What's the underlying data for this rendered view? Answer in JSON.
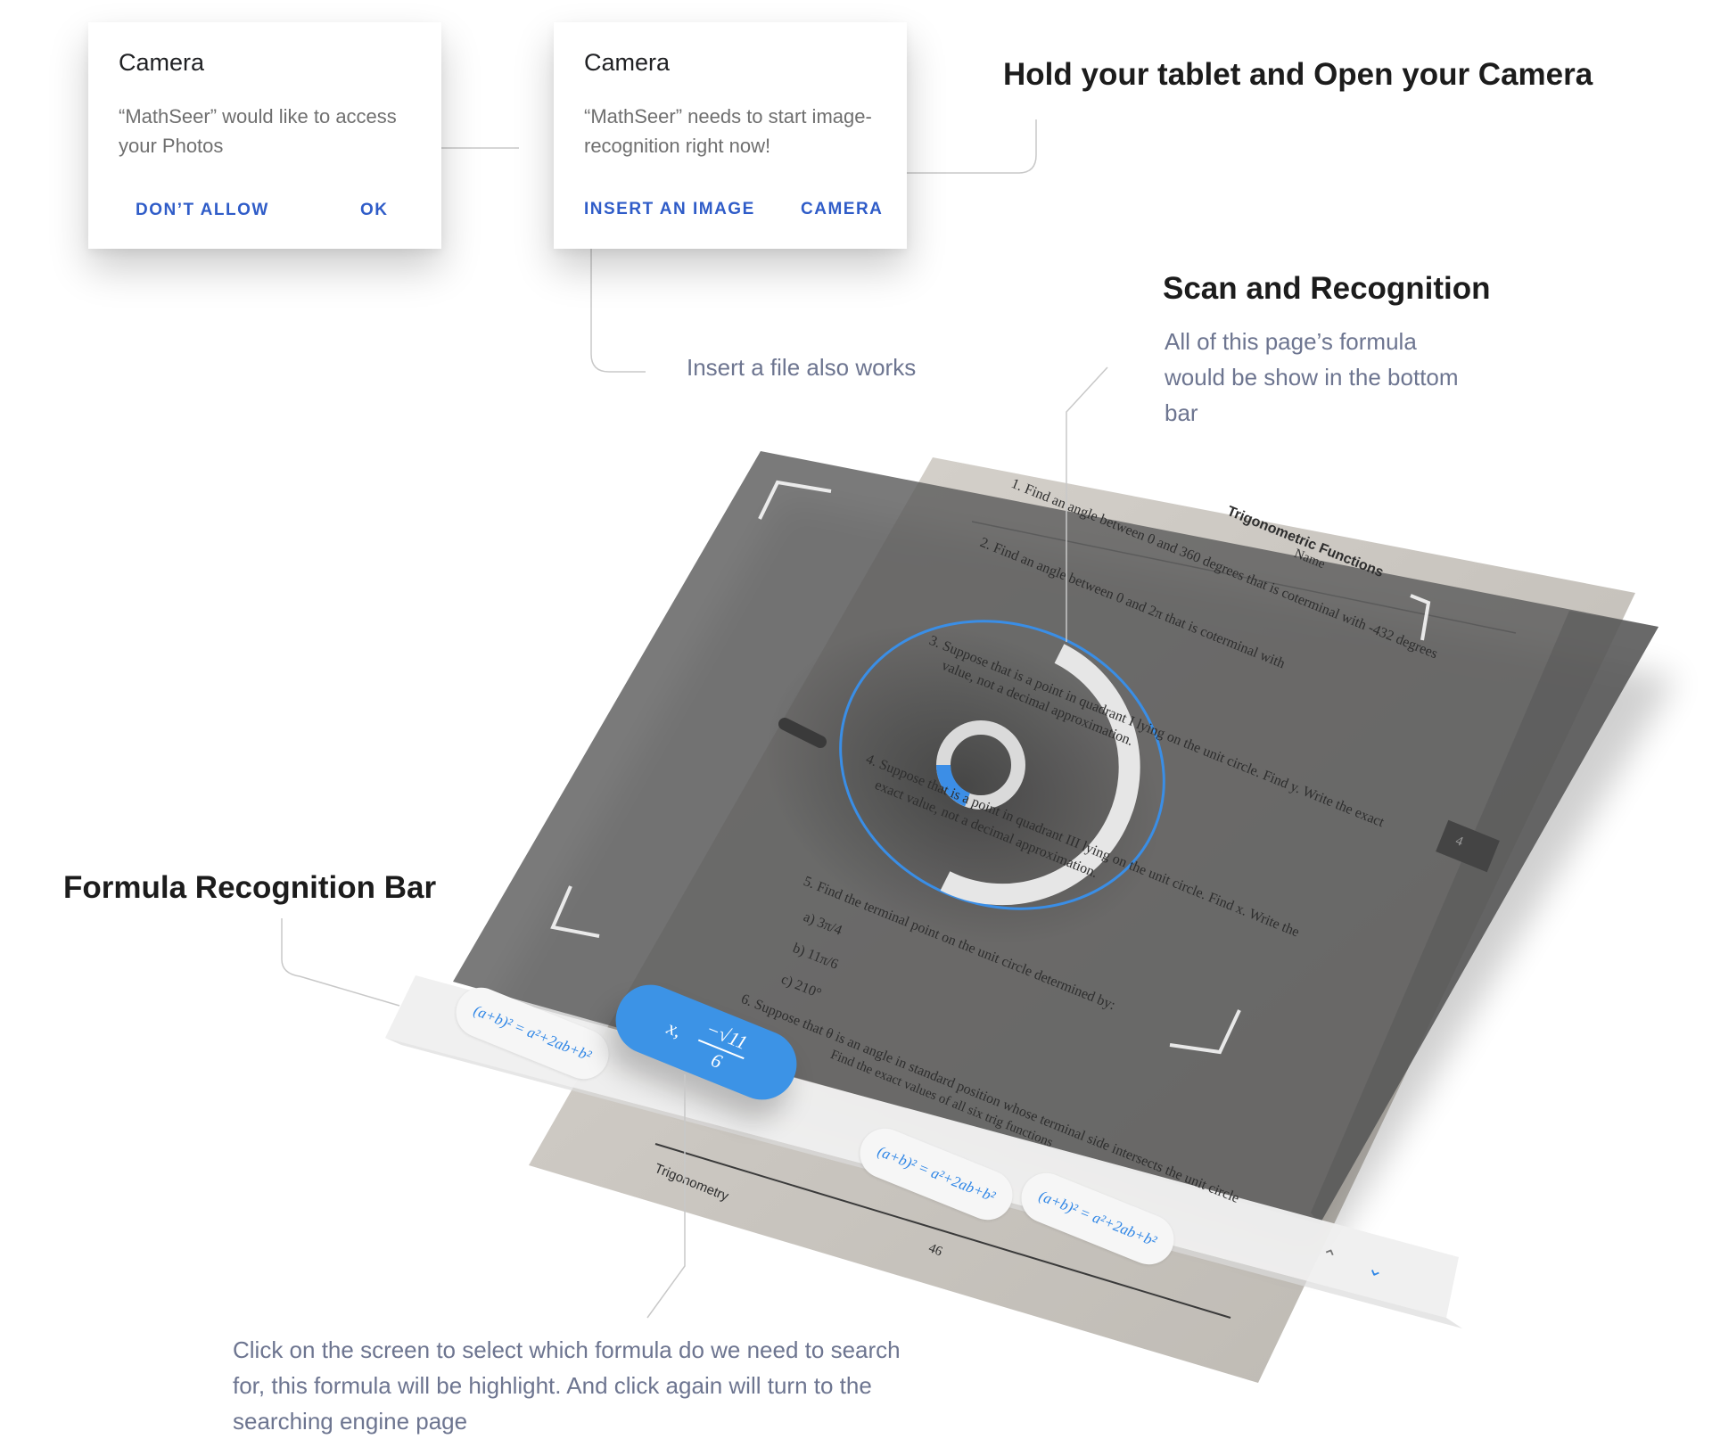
{
  "dialogs": {
    "photos": {
      "title": "Camera",
      "body": "“MathSeer” would like to access your Photos",
      "deny_label": "DON’T ALLOW",
      "ok_label": "OK"
    },
    "camera": {
      "title": "Camera",
      "body": "“MathSeer” needs to start image-recognition right now!",
      "insert_label": "INSERT AN IMAGE",
      "camera_label": "CAMERA"
    }
  },
  "headings": {
    "hold": "Hold your tablet and Open your Camera",
    "scan": "Scan and Recognition",
    "bar": "Formula Recognition Bar"
  },
  "notes": {
    "insert": "Insert a file also works",
    "scan": "All of this page’s formula would be show in the bottom bar",
    "click": "Click on the screen to select which formula do we need to search for, this formula will be highlight. And click again will turn to the searching engine page"
  },
  "formula_bar": {
    "chips": [
      "(a+b)² = a²+2ab+b²",
      "(a+b)² = a²+2ab+b²",
      "(a+b)² = a²+2ab+b²"
    ],
    "active": {
      "var": "x,",
      "numerator": "−√11",
      "denominator": "6"
    },
    "up_icon": "chevron-up-icon",
    "down_icon": "chevron-down-icon"
  },
  "paper": {
    "heading": "Trigonometric Functions",
    "name_label": "Name",
    "q1": "1.  Find an angle between 0 and 360 degrees that is coterminal with -432 degrees",
    "q2": "2.  Find an angle between 0 and 2π that is coterminal with",
    "q3": "3.  Suppose that                is a point in quadrant I lying on the unit circle. Find y. Write the exact",
    "q3b": "value, not a decimal approximation.",
    "q4": "4.  Suppose that                is a point in quadrant III lying on the unit circle. Find x. Write the",
    "q4b": "exact value, not a decimal approximation.",
    "q5": "5.  Find the terminal point on the unit circle determined by:",
    "q5a": "a)  3π/4",
    "q5b": "b)  11π/6",
    "q5c": "c)  210°",
    "q6": "6.  Suppose that θ is an angle in standard position whose terminal side intersects the unit circle",
    "q6b": "Find the exact values of all six trig functions",
    "footer": "Trigonometry",
    "page_number": "46",
    "badge": "4"
  },
  "colors": {
    "accent": "#2f5cc8",
    "formula_blue": "#3c93e6",
    "note_gray": "#6d7590",
    "overlay": "#606060"
  }
}
